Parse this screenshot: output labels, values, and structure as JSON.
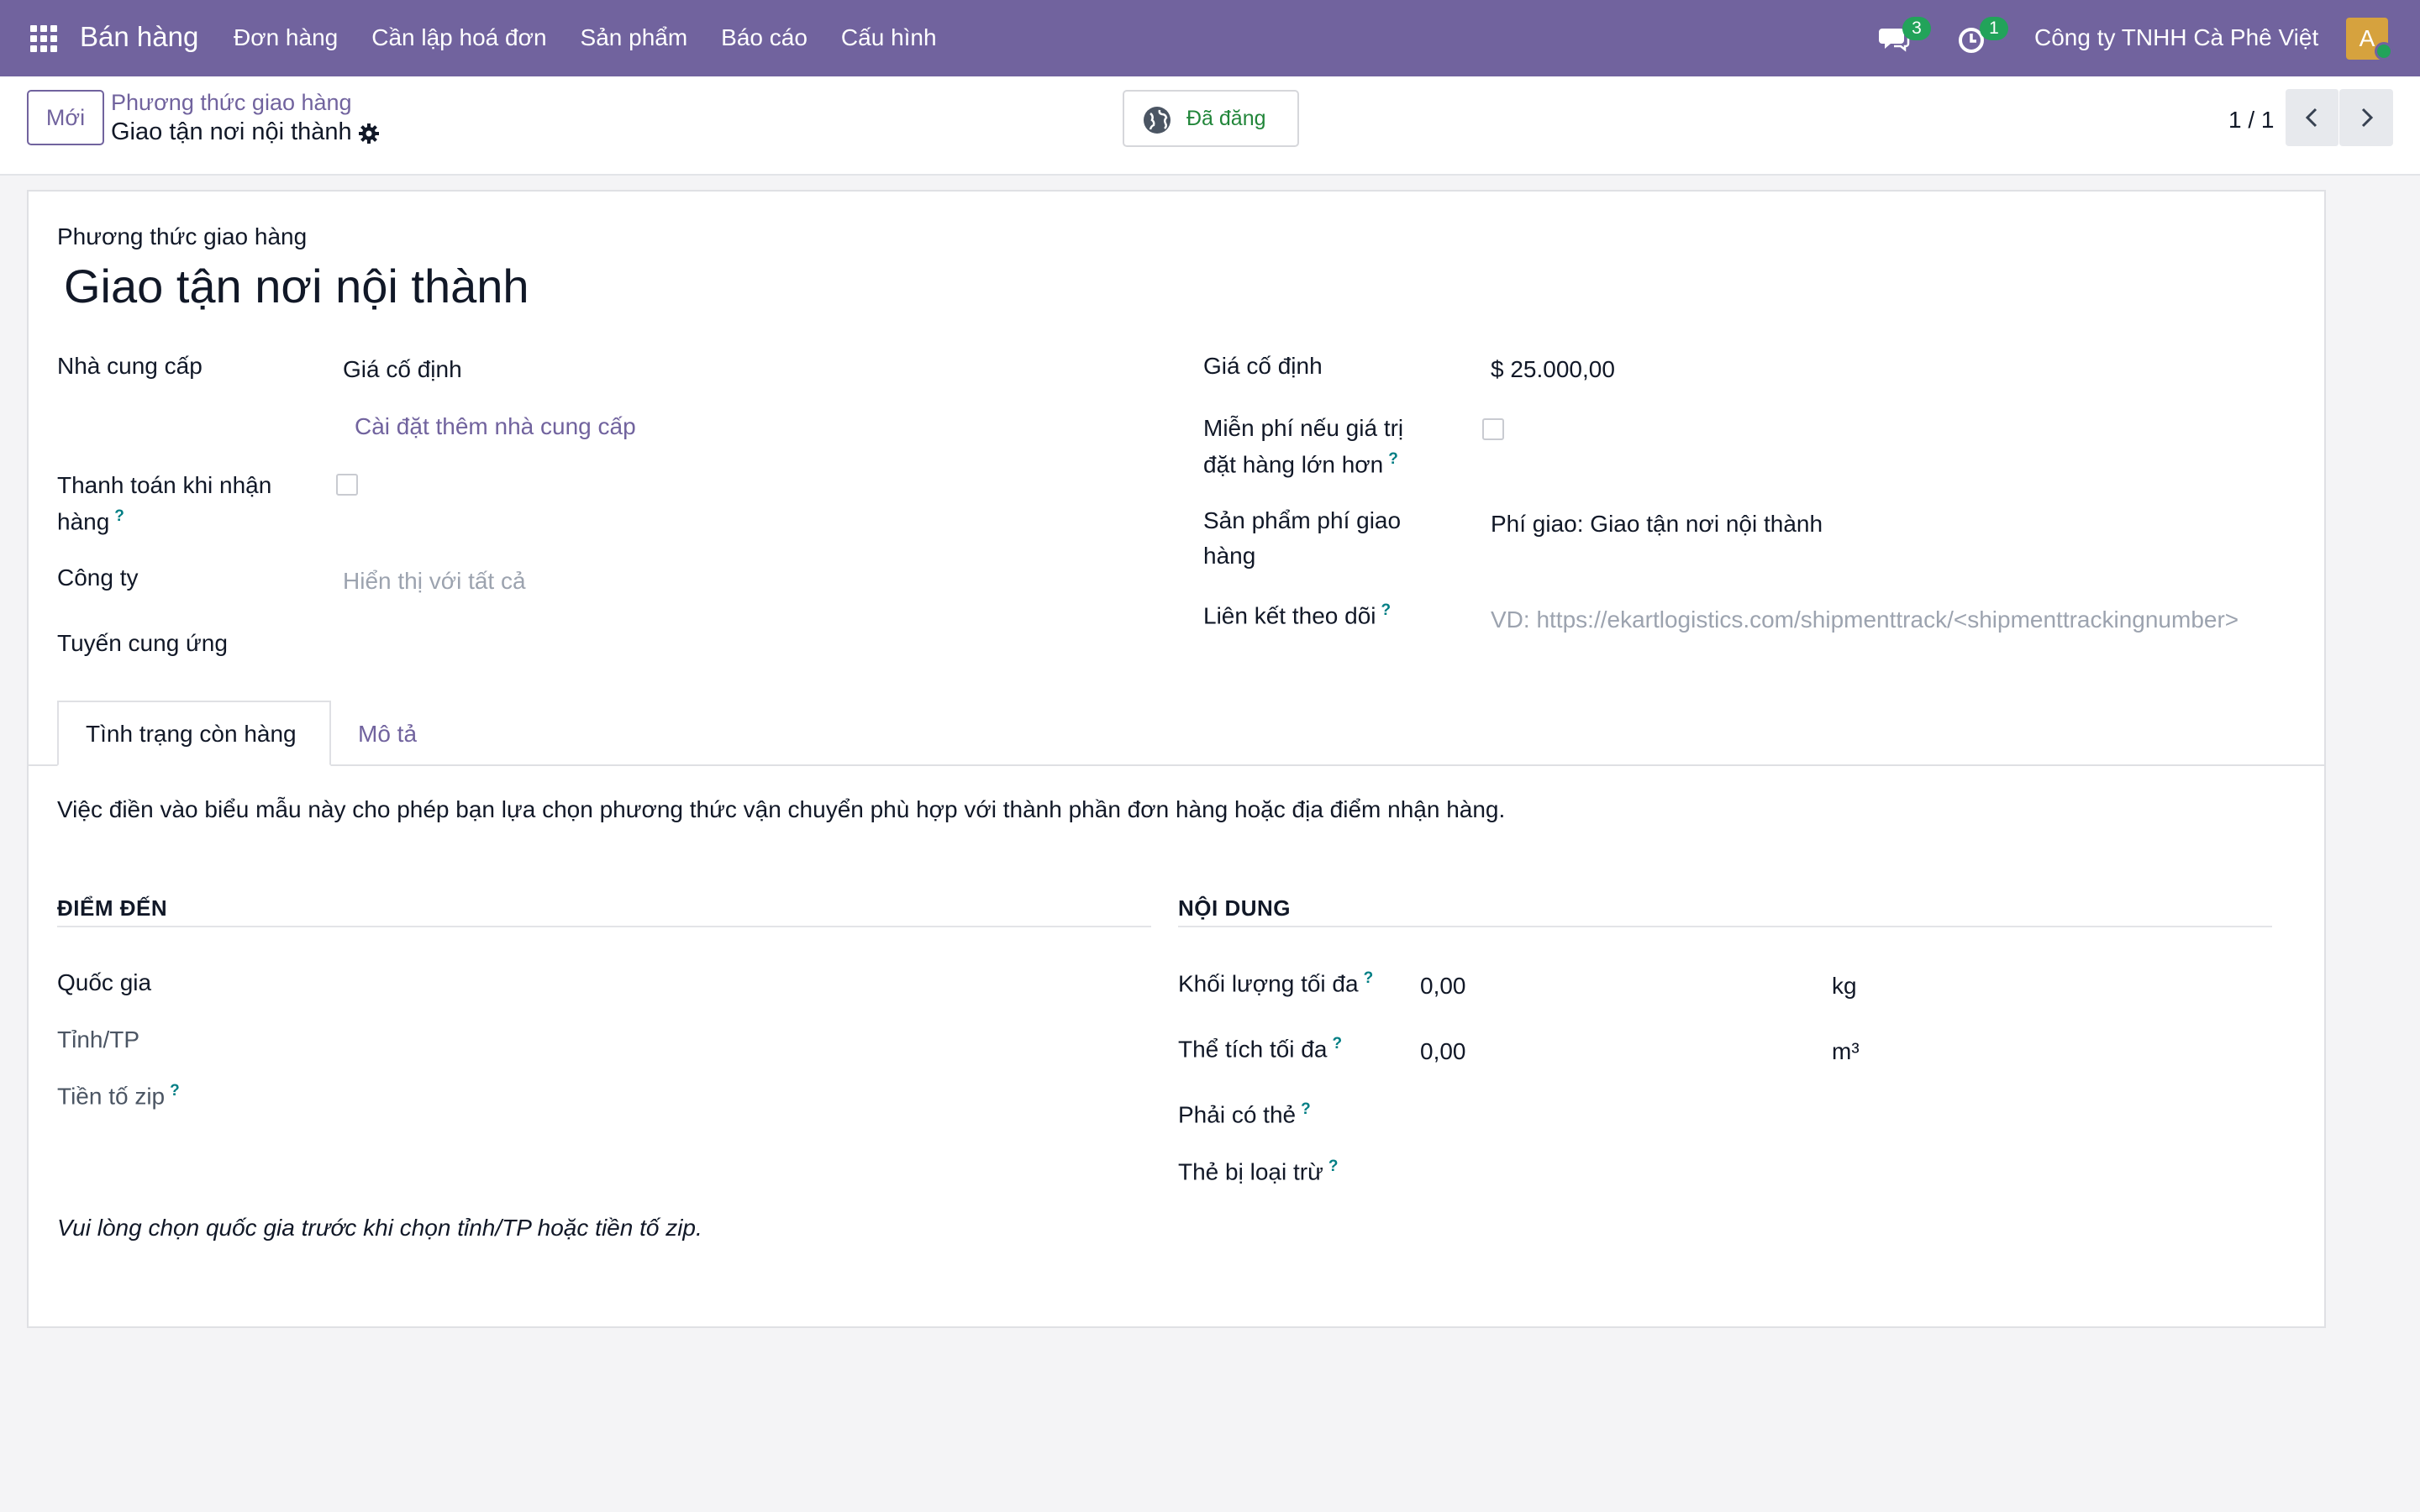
{
  "navbar": {
    "app_name": "Bán hàng",
    "menu": [
      "Đơn hàng",
      "Cần lập hoá đơn",
      "Sản phẩm",
      "Báo cáo",
      "Cấu hình"
    ],
    "messages_count": "3",
    "activities_count": "1",
    "company": "Công ty TNHH Cà Phê Việt",
    "avatar_letter": "A"
  },
  "control": {
    "new_label": "Mới",
    "breadcrumb_parent": "Phương thức giao hàng",
    "breadcrumb_current": "Giao tận nơi nội thành",
    "published_label": "Đã đăng",
    "pager": "1 / 1"
  },
  "form": {
    "model_label": "Phương thức giao hàng",
    "name": "Giao tận nơi nội thành",
    "provider_label": "Nhà cung cấp",
    "provider_value": "Giá cố định",
    "install_more_link": "Cài đặt thêm nhà cung cấp",
    "cod_label_1": "Thanh toán khi nhận",
    "cod_label_2": "hàng",
    "company_label": "Công ty",
    "company_placeholder": "Hiển thị với tất cả",
    "route_label": "Tuyến cung ứng",
    "fixed_price_label": "Giá cố định",
    "fixed_price_value": "$ 25.000,00",
    "free_if_label_1": "Miễn phí nếu giá trị",
    "free_if_label_2": "đặt hàng lớn hơn",
    "delivery_product_label_1": "Sản phẩm phí giao",
    "delivery_product_label_2": "hàng",
    "delivery_product_value": "Phí giao: Giao tận nơi nội thành",
    "tracking_label": "Liên kết theo dõi",
    "tracking_placeholder": "VD: https://ekartlogistics.com/shipmenttrack/<shipmenttrackingnumber>",
    "help_mark": "?"
  },
  "tabs": {
    "availability": "Tình trạng còn hàng",
    "description": "Mô tả"
  },
  "availability": {
    "intro": "Việc điền vào biểu mẫu này cho phép bạn lựa chọn phương thức vận chuyển phù hợp với thành phần đơn hàng hoặc địa điểm nhận hàng.",
    "destination_head": "ĐIỂM ĐẾN",
    "country_label": "Quốc gia",
    "state_label": "Tỉnh/TP",
    "zip_label": "Tiền tố zip",
    "content_head": "NỘI DUNG",
    "max_weight_label": "Khối lượng tối đa",
    "max_weight_value": "0,00",
    "weight_unit": "kg",
    "max_volume_label": "Thể tích tối đa",
    "max_volume_value": "0,00",
    "volume_unit": "m³",
    "must_tags_label": "Phải có thẻ",
    "excluded_tags_label": "Thẻ bị loại trừ",
    "note": "Vui lòng chọn quốc gia trước khi chọn tỉnh/TP hoặc tiền tố zip."
  }
}
